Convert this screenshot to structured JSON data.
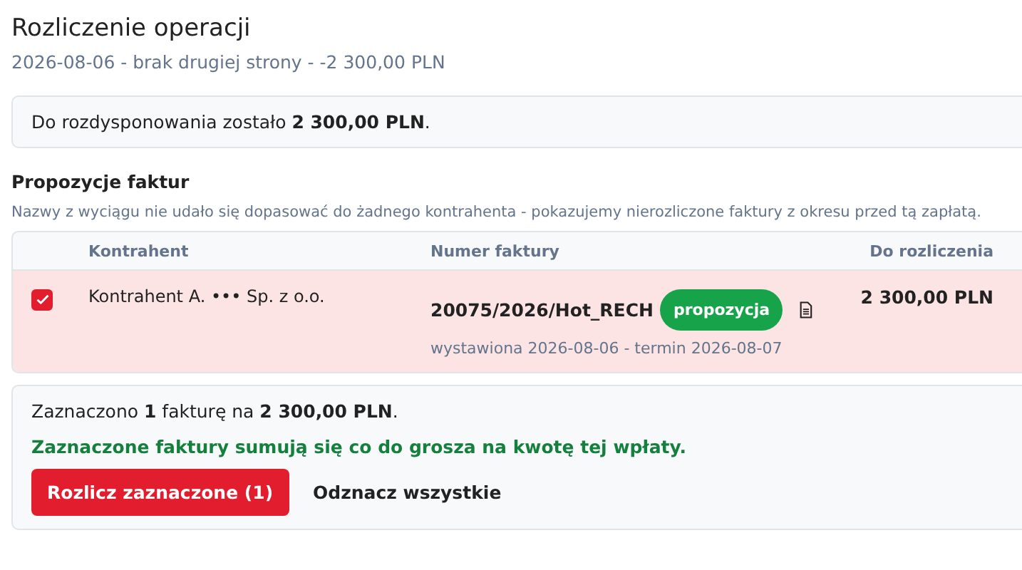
{
  "title": "Rozliczenie operacji",
  "subtitle": "2026-08-06 - brak drugiej strony - -2 300,00 PLN",
  "remaining": "Do rozdysponowania zostało **2 300,00 PLN**.",
  "section": {
    "title": "Propozycje faktur",
    "note": "Nazwy z wyciągu nie udało się dopasować do żadnego kontrahenta - pokazujemy nierozliczone faktury z okresu przed tą zapłatą."
  },
  "table": {
    "columns": [
      "Kontrahent",
      "Numer faktury",
      "Do rozliczenia"
    ],
    "rows": [
      {
        "checked": true,
        "contractor": "Kontrahent A. ••• Sp. z o.o.",
        "invoice": "20075/2026/Hot_RECH",
        "badge": "propozycja",
        "dates": "wystawiona 2026-08-06 - termin 2026-08-07",
        "amount": "2 300,00 PLN"
      }
    ]
  },
  "summary": {
    "selected": "Zaznaczono **1** fakturę na **2 300,00 PLN**.",
    "status": "Zaznaczone faktury sumują się co do grosza na kwotę tej wpłaty.",
    "primary_button": "Rozlicz zaznaczone (1)",
    "secondary_button": "Odznacz wszystkie"
  }
}
